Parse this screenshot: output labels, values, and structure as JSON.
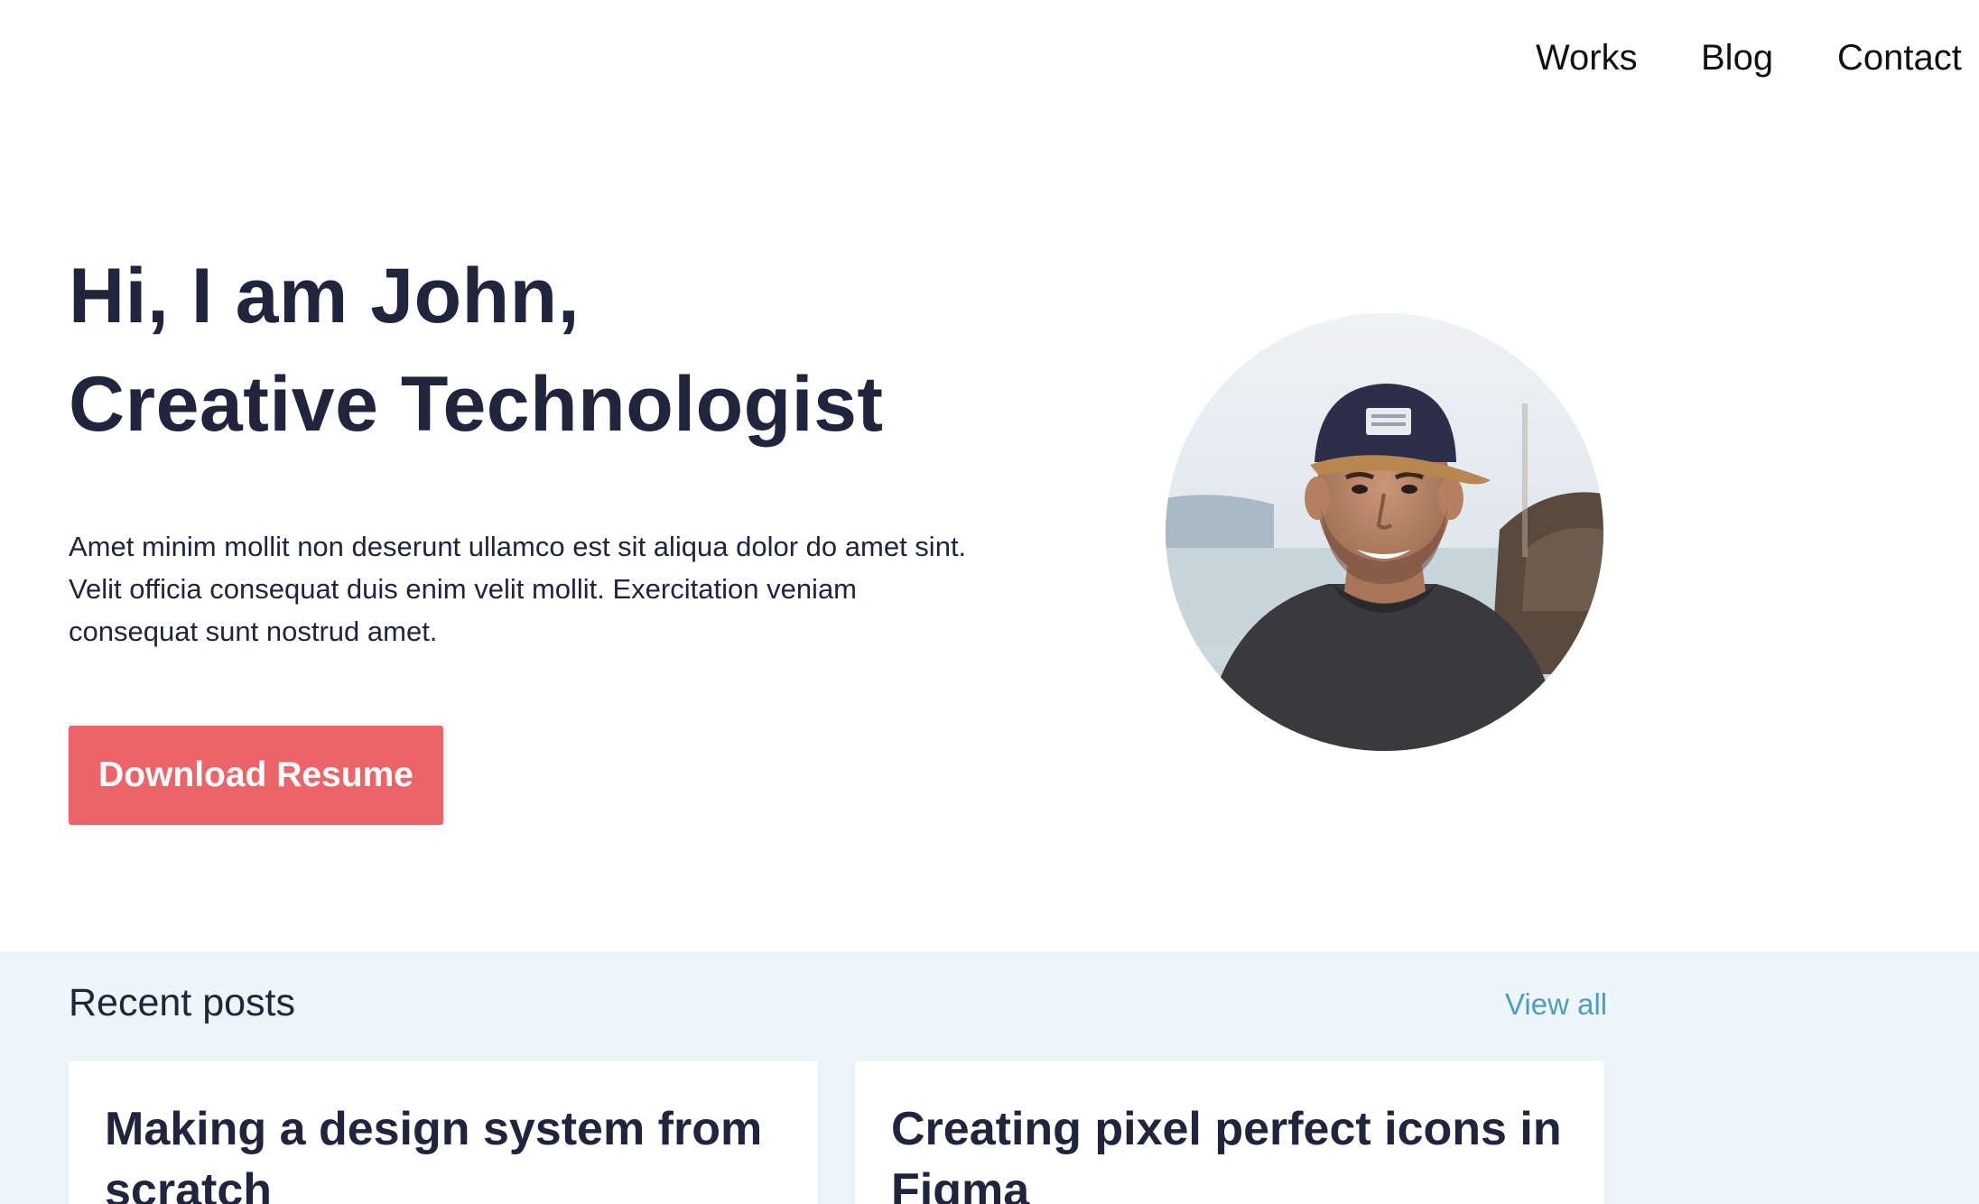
{
  "nav": {
    "items": [
      {
        "label": "Works"
      },
      {
        "label": "Blog"
      },
      {
        "label": "Contact"
      }
    ]
  },
  "hero": {
    "title_line1": "Hi, I am John,",
    "title_line2": "Creative Technologist",
    "description": "Amet minim mollit non deserunt ullamco est sit aliqua dolor do amet sint. Velit officia consequat duis enim velit mollit. Exercitation veniam consequat sunt nostrud amet.",
    "button_label": "Download Resume"
  },
  "recent_posts": {
    "heading": "Recent posts",
    "view_all_label": "View all",
    "posts": [
      {
        "title": "Making a design system from scratch"
      },
      {
        "title": "Creating pixel perfect icons in Figma"
      }
    ]
  },
  "colors": {
    "heading": "#21243d",
    "accent_button": "#ed6468",
    "link": "#4f9cc0",
    "section_bg": "#edf7fa"
  }
}
